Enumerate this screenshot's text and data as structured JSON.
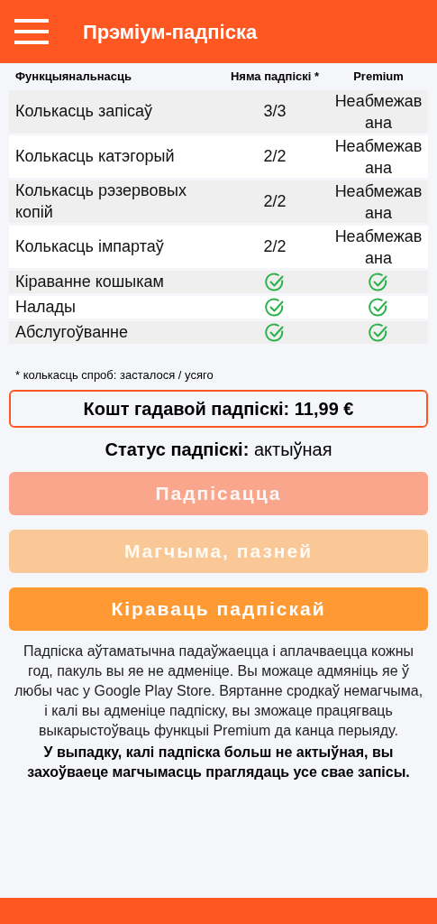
{
  "app_bar": {
    "title": "Прэміум-падпіска"
  },
  "table": {
    "columns": [
      "Функцыянальнасць",
      "Няма падпіскі *",
      "Premium"
    ],
    "rows": [
      {
        "feature": "Колькасць запісаў",
        "free": {
          "kind": "text",
          "value": "3/3"
        },
        "premium": {
          "kind": "text",
          "value": "Неабмежавана"
        }
      },
      {
        "feature": "Колькасць катэгорый",
        "free": {
          "kind": "text",
          "value": "2/2"
        },
        "premium": {
          "kind": "text",
          "value": "Неабмежавана"
        }
      },
      {
        "feature": "Колькасць рэзервовых копій",
        "free": {
          "kind": "text",
          "value": "2/2"
        },
        "premium": {
          "kind": "text",
          "value": "Неабмежавана"
        }
      },
      {
        "feature": "Колькасць імпартаў",
        "free": {
          "kind": "text",
          "value": "2/2"
        },
        "premium": {
          "kind": "text",
          "value": "Неабмежавана"
        }
      },
      {
        "feature": "Кіраванне кошыкам",
        "free": {
          "kind": "check"
        },
        "premium": {
          "kind": "check"
        }
      },
      {
        "feature": "Налады",
        "free": {
          "kind": "check"
        },
        "premium": {
          "kind": "check"
        }
      },
      {
        "feature": "Абслугоўванне",
        "free": {
          "kind": "check"
        },
        "premium": {
          "kind": "check"
        }
      }
    ]
  },
  "footnote": "* колькасць спроб: засталося / усяго",
  "price": "Кошт гадавой падпіскі: 11,99 €",
  "status": "**Статус падпіскі:** актыўная",
  "buttons": [
    {
      "label": "Падпісацца",
      "kind": "subscribe",
      "disabled": true
    },
    {
      "label": "Магчыма, пазней",
      "kind": "later",
      "disabled": true
    },
    {
      "label": "Кіраваць падпіскай",
      "kind": "manage",
      "disabled": false
    }
  ],
  "notice": "Падпіска аўтаматычна падаўжаецца і аплачваецца кожны год, пакуль вы яе не адменіце. Вы можаце адмяніць яе ў любы час у Google Play Store. Вяртанне сродкаў немагчыма, і калі вы адменіце падпіску, вы зможаце працягваць выкарыстоўваць функцыі Premium да канца перыяду.",
  "warning": "У выпадку, калі падпіска больш не актыўная, вы захоўваеце магчымасць праглядаць усе свае запісы."
}
